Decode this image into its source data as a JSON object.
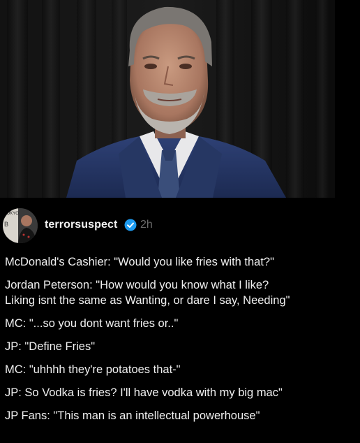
{
  "post": {
    "username": "terrorsuspect",
    "time": "2h",
    "verified_color": "#1d9bf0",
    "avatar_text_top": "TOKYO",
    "avatar_text_side": "B",
    "lines": [
      "McDonald's Cashier: \"Would you like fries with that?\"",
      "Jordan Peterson: \"How would you know what I like?",
      "Liking isnt the same as Wanting, or dare I say, Needing\"",
      "MC: \"...so you dont want fries or..\"",
      "JP: \"Define Fries\"",
      "MC: \"uhhhh they're potatoes that-\"",
      "JP: So Vodka is fries? I'll have vodka with my big mac\"",
      "JP Fans: \"This man is an intellectual powerhouse\""
    ]
  }
}
